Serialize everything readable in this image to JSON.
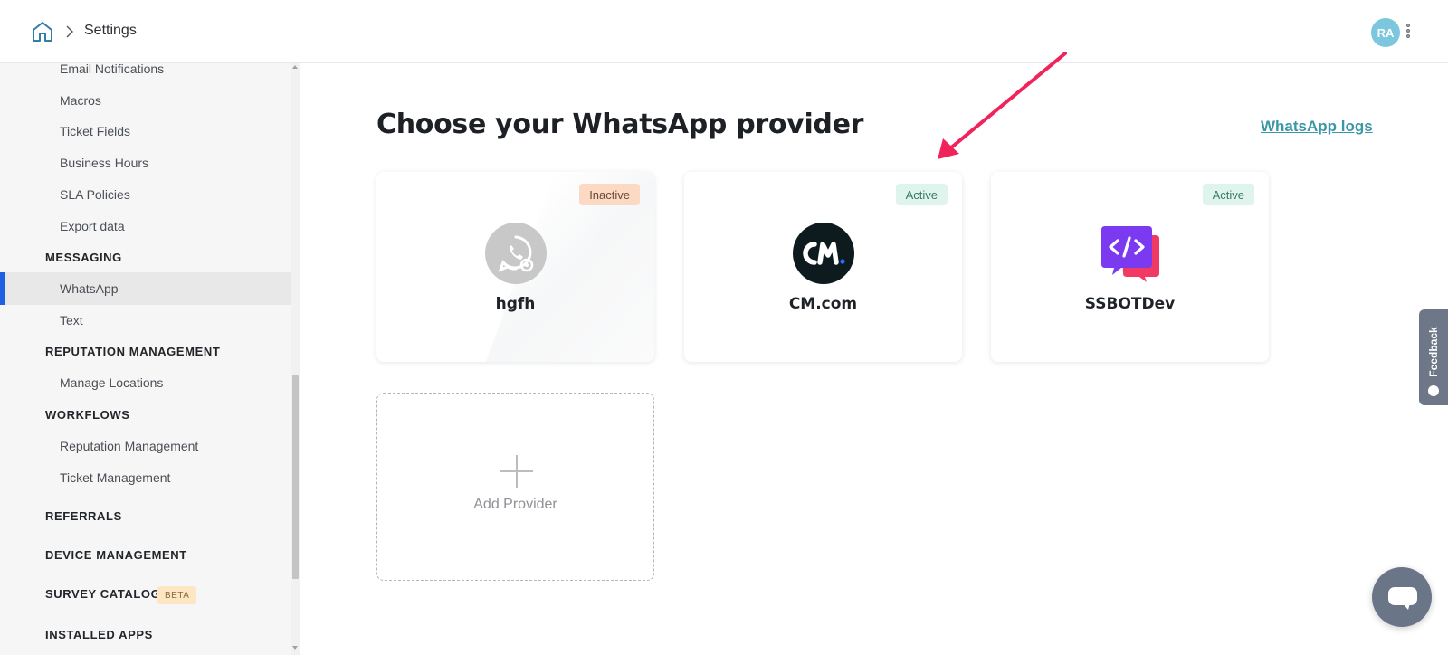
{
  "header": {
    "home_icon": "home-icon",
    "breadcrumb_title": "Settings",
    "avatar_initials": "RA",
    "menu_icon": "more-vertical-icon"
  },
  "sidebar": {
    "items": [
      {
        "label": "Email Notifications",
        "type": "item"
      },
      {
        "label": "Macros",
        "type": "item"
      },
      {
        "label": "Ticket Fields",
        "type": "item"
      },
      {
        "label": "Business Hours",
        "type": "item"
      },
      {
        "label": "SLA Policies",
        "type": "item"
      },
      {
        "label": "Export data",
        "type": "item"
      },
      {
        "label": "MESSAGING",
        "type": "section"
      },
      {
        "label": "WhatsApp",
        "type": "item",
        "active": true
      },
      {
        "label": "Text",
        "type": "item"
      },
      {
        "label": "REPUTATION MANAGEMENT",
        "type": "section"
      },
      {
        "label": "Manage Locations",
        "type": "item"
      },
      {
        "label": "WORKFLOWS",
        "type": "section"
      },
      {
        "label": "Reputation Management",
        "type": "item"
      },
      {
        "label": "Ticket Management",
        "type": "item"
      },
      {
        "label": "REFERRALS",
        "type": "section"
      },
      {
        "label": "DEVICE MANAGEMENT",
        "type": "section"
      },
      {
        "label": "SURVEY CATALOG",
        "type": "section",
        "badge": "BETA"
      },
      {
        "label": "INSTALLED APPS",
        "type": "section"
      }
    ],
    "active_accent": "#1f5fe0"
  },
  "main": {
    "title": "Choose your WhatsApp provider",
    "logs_link": "WhatsApp logs",
    "providers": [
      {
        "name": "hgfh",
        "status": "Inactive",
        "logo": "whatsapp-gear-icon"
      },
      {
        "name": "CM.com",
        "status": "Active",
        "logo": "cm-com-logo"
      },
      {
        "name": "SSBOTDev",
        "status": "Active",
        "logo": "code-chat-icon"
      }
    ],
    "add_provider_label": "Add Provider"
  },
  "widgets": {
    "feedback_label": "Feedback",
    "chat_icon": "chat-bubble-icon"
  },
  "colors": {
    "link": "#3a97a6",
    "inactive_badge": "#fcd9c2",
    "active_badge": "#dff4ec",
    "arrow": "#f0245a",
    "avatar": "#7cc7dd"
  }
}
